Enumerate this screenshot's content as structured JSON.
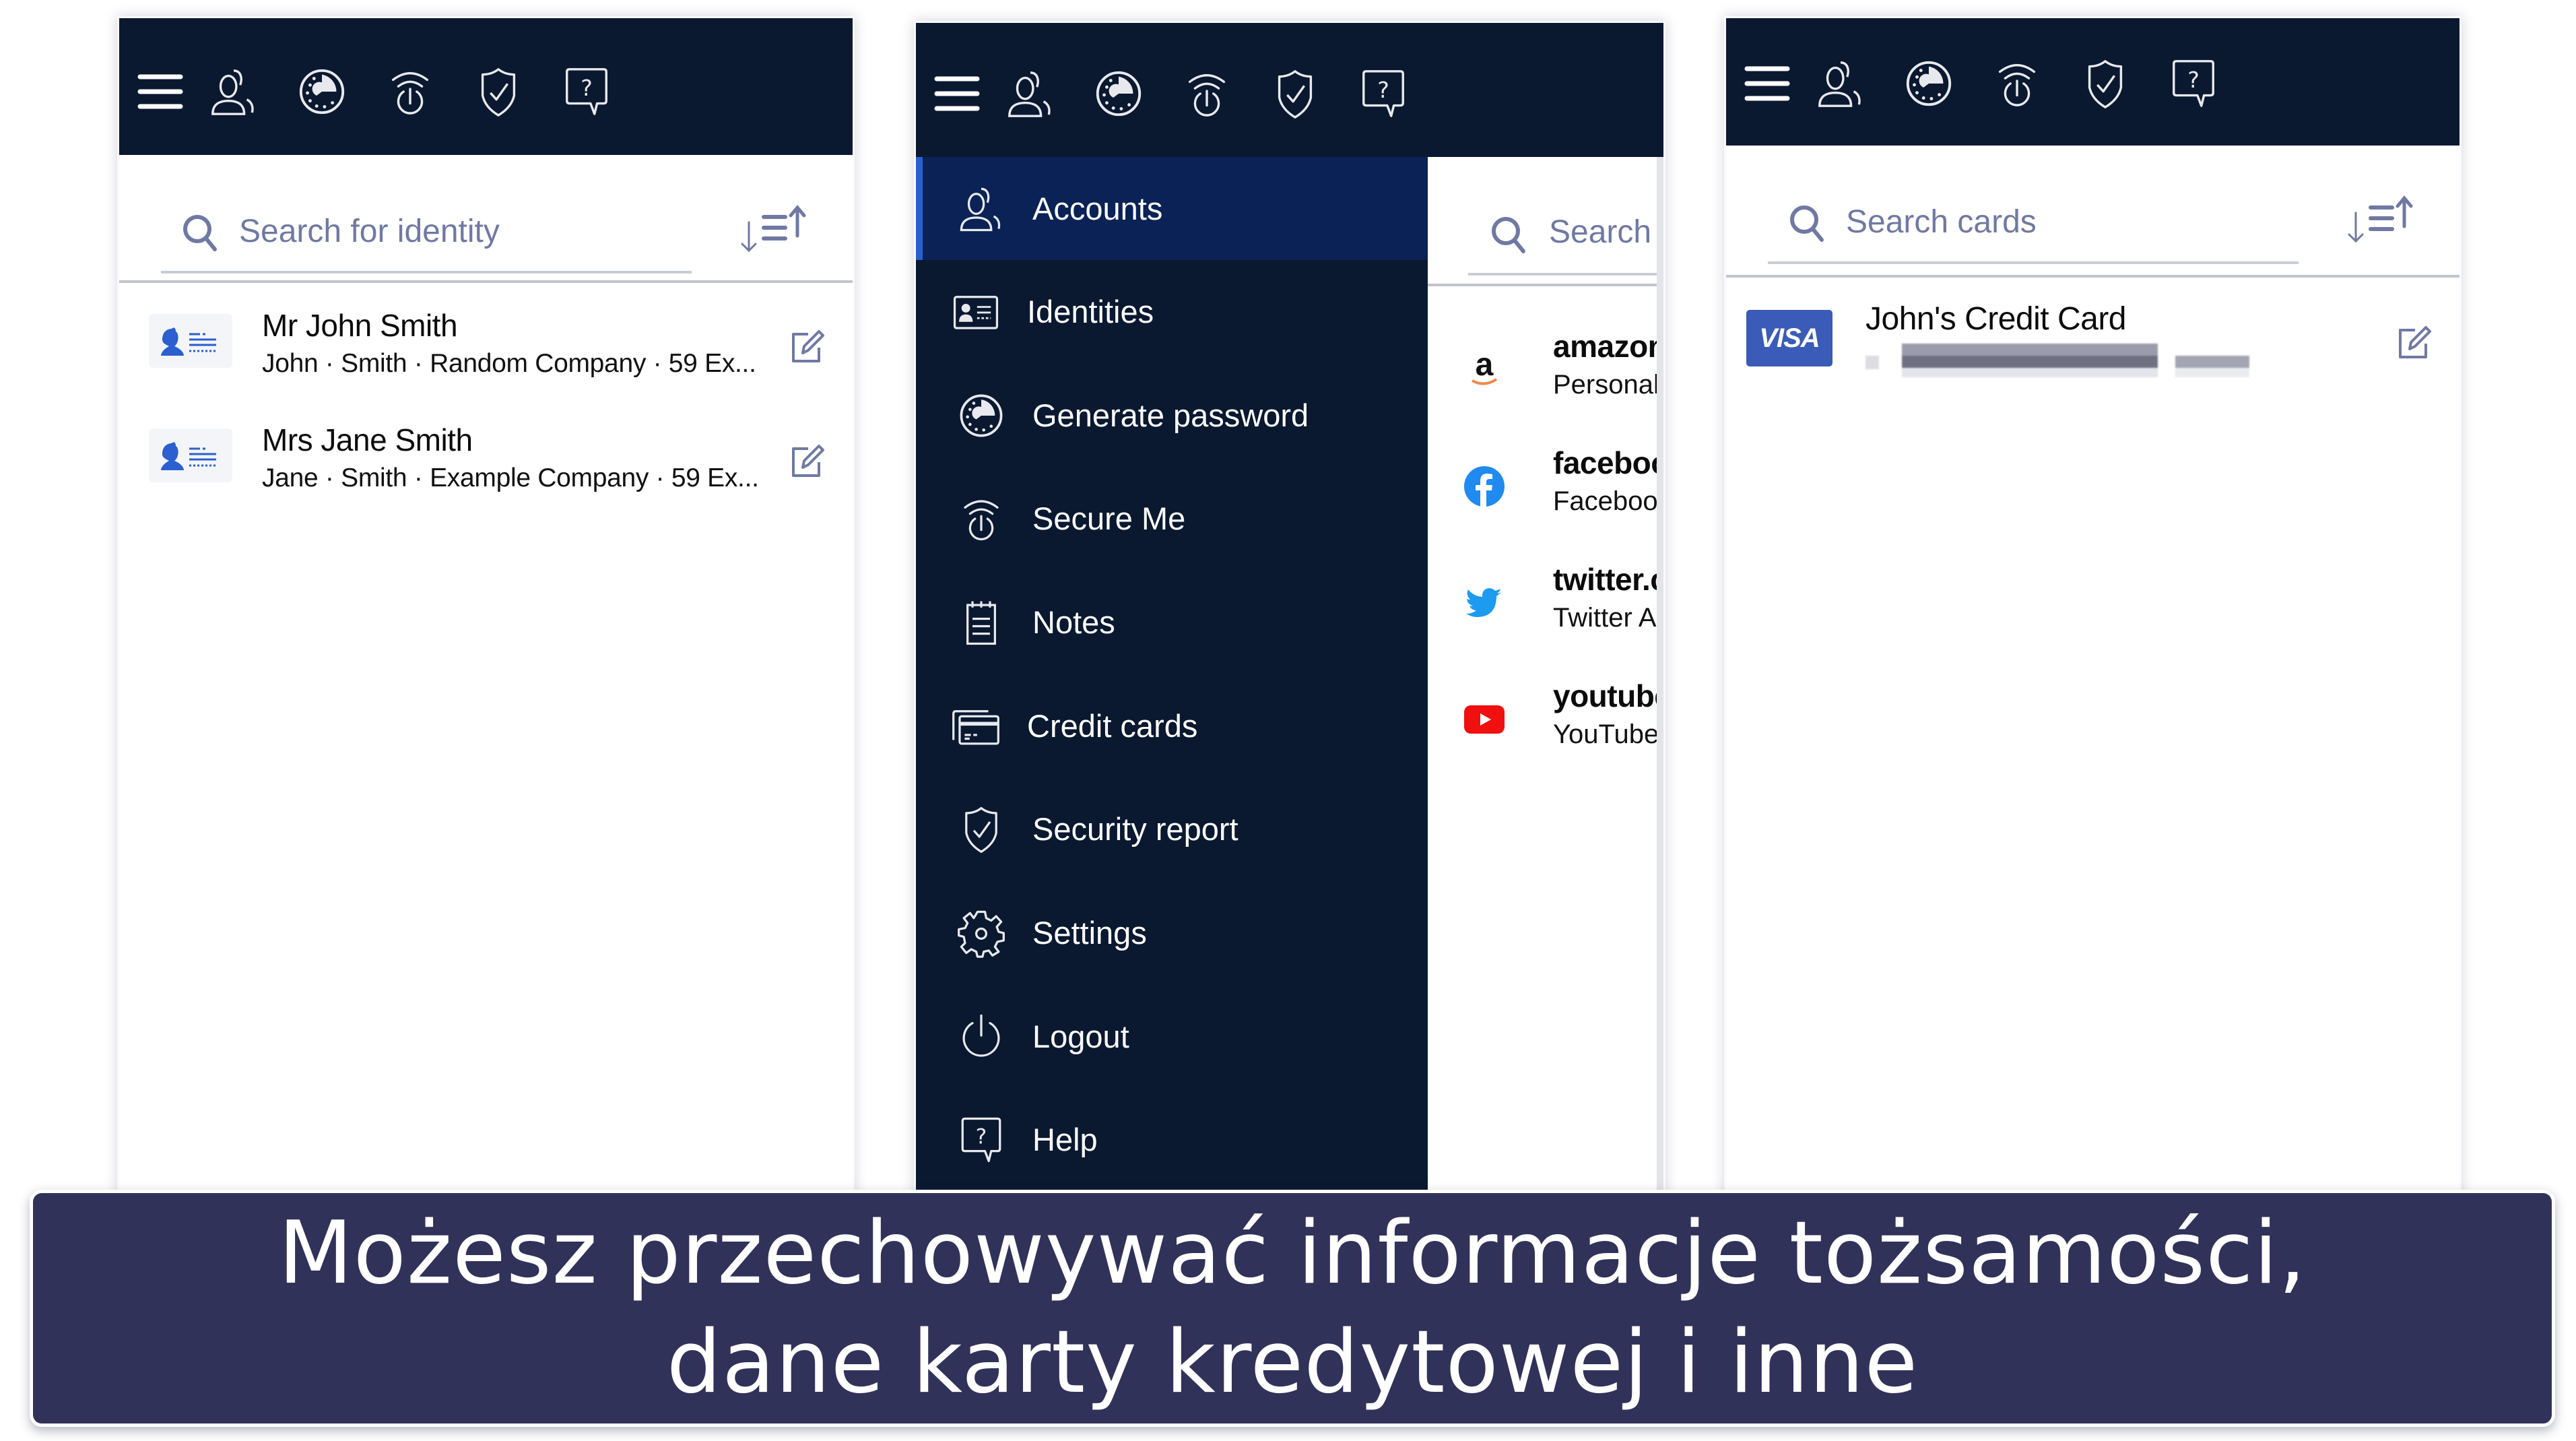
{
  "panels": {
    "identities": {
      "toolbar_icons": [
        "menu-icon",
        "accounts-icon",
        "generate-password-icon",
        "secure-me-icon",
        "security-report-icon",
        "help-icon"
      ],
      "search_placeholder": "Search for identity",
      "sort_icon": "sort-icon",
      "items": [
        {
          "title": "Mr John Smith",
          "subtitle": "John · Smith · Random Company · 59 Ex...",
          "icon": "identity-card-icon",
          "action_icon": "edit-icon"
        },
        {
          "title": "Mrs Jane Smith",
          "subtitle": "Jane · Smith · Example Company · 59 Ex...",
          "icon": "identity-card-icon",
          "action_icon": "edit-icon"
        }
      ]
    },
    "menu": {
      "toolbar_icons": [
        "menu-icon",
        "accounts-icon",
        "generate-password-icon",
        "secure-me-icon",
        "security-report-icon",
        "help-icon"
      ],
      "drawer_items": [
        {
          "label": "Accounts",
          "icon": "accounts-icon",
          "active": true
        },
        {
          "label": "Identities",
          "icon": "identity-card-icon",
          "active": false
        },
        {
          "label": "Generate password",
          "icon": "generate-password-icon",
          "active": false
        },
        {
          "label": "Secure Me",
          "icon": "secure-me-icon",
          "active": false
        },
        {
          "label": "Notes",
          "icon": "notes-icon",
          "active": false
        },
        {
          "label": "Credit cards",
          "icon": "credit-cards-icon",
          "active": false
        },
        {
          "label": "Security report",
          "icon": "security-report-icon",
          "active": false
        },
        {
          "label": "Settings",
          "icon": "gear-icon",
          "active": false
        },
        {
          "label": "Logout",
          "icon": "power-icon",
          "active": false
        },
        {
          "label": "Help",
          "icon": "help-icon",
          "active": false
        }
      ],
      "accounts_search_placeholder": "Search",
      "accounts": [
        {
          "title": "amazon",
          "subtitle": "Personal",
          "icon": "amazon-logo-icon"
        },
        {
          "title": "faceboo",
          "subtitle": "Faceboo",
          "icon": "facebook-logo-icon"
        },
        {
          "title": "twitter.c",
          "subtitle": "Twitter A",
          "icon": "twitter-logo-icon"
        },
        {
          "title": "youtube",
          "subtitle": "YouTube",
          "icon": "youtube-logo-icon"
        }
      ]
    },
    "cards": {
      "toolbar_icons": [
        "menu-icon",
        "accounts-icon",
        "generate-password-icon",
        "secure-me-icon",
        "security-report-icon",
        "help-icon"
      ],
      "search_placeholder": "Search cards",
      "sort_icon": "sort-icon",
      "items": [
        {
          "title": "John's Credit Card",
          "brand": "VISA",
          "number_obscured": true,
          "action_icon": "edit-icon"
        }
      ]
    }
  },
  "colors": {
    "header": "#0a1830",
    "active_item": "#0a2255",
    "active_accent": "#2b5fcf",
    "muted_icon": "#7079a3",
    "banner": "#31325a",
    "identity_icon": "#2c5fcf",
    "visa": "#3a5bb7"
  },
  "caption": {
    "line1": "Możesz przechowywać informacje tożsamości,",
    "line2": "dane karty kredytowej i inne"
  }
}
